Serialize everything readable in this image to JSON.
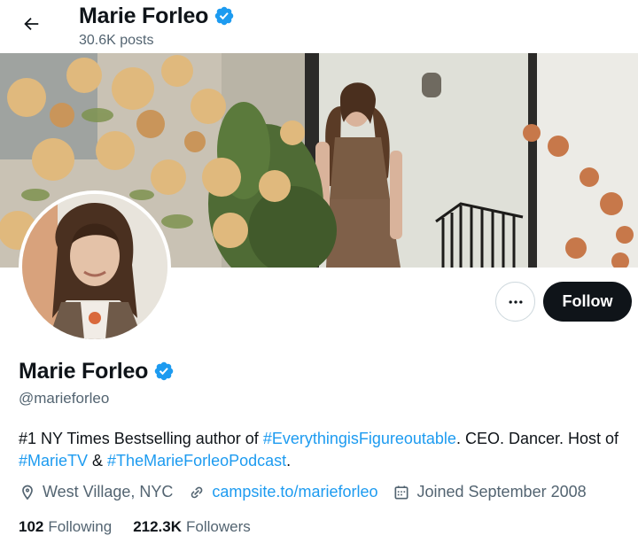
{
  "header": {
    "name": "Marie Forleo",
    "posts": "30.6K posts"
  },
  "profile": {
    "name": "Marie Forleo",
    "handle": "@marieforleo",
    "verified": true,
    "follow_label": "Follow"
  },
  "bio": {
    "part1": "#1 NY Times Bestselling author of ",
    "tag1": "#EverythingisFigureoutable",
    "part2": ". CEO. Dancer. Host of ",
    "tag2": "#MarieTV",
    "part3": " & ",
    "tag3": "#TheMarieForleoPodcast",
    "part4": "."
  },
  "meta": {
    "location": "West Village, NYC",
    "website": "campsite.to/marieforleo",
    "joined": "Joined September 2008"
  },
  "stats": {
    "following_count": "102",
    "following_label": "Following",
    "followers_count": "212.3K",
    "followers_label": "Followers"
  },
  "colors": {
    "accent": "#1d9bf0",
    "text_primary": "#0f1419",
    "text_secondary": "#536471",
    "follow_bg": "#0f1419"
  },
  "icons": {
    "back": "arrow-left-icon",
    "verified": "verified-badge-icon",
    "more": "more-icon",
    "location": "location-pin-icon",
    "website": "link-icon",
    "joined": "calendar-icon"
  }
}
